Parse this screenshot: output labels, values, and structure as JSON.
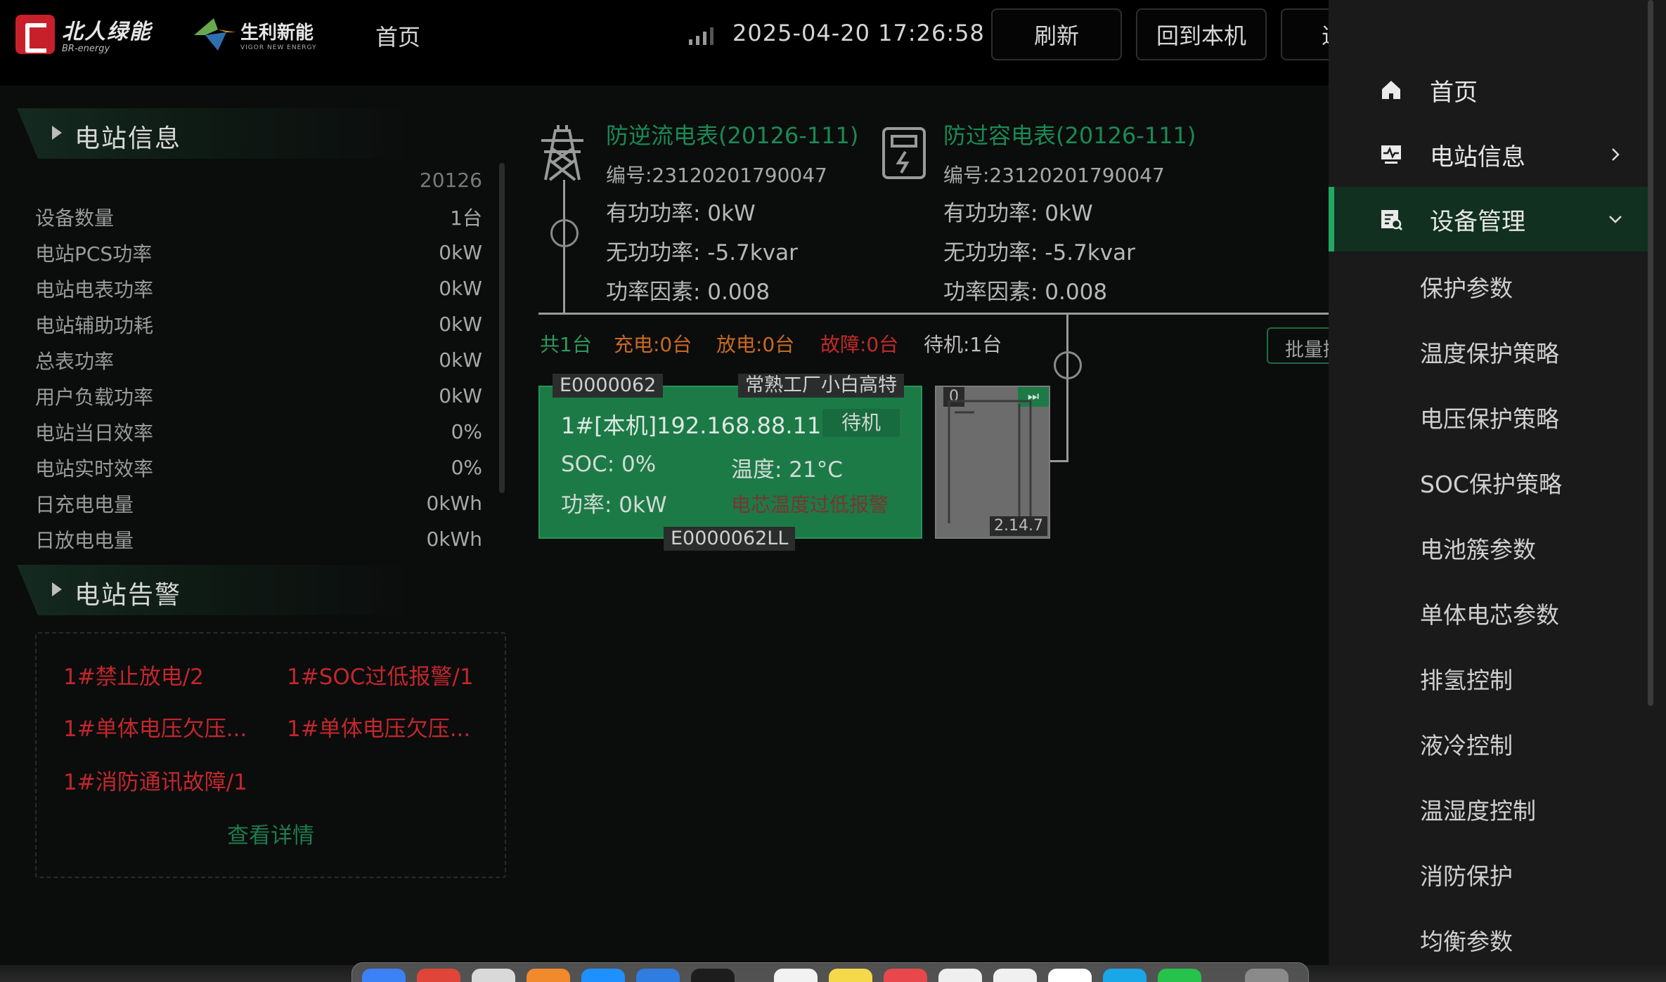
{
  "topbar": {
    "logo1_cn": "北人绿能",
    "logo1_en": "BR-energy",
    "logo2_cn": "生利新能",
    "logo2_en": "VIGOR NEW ENERGY",
    "nav_home": "首页",
    "datetime": "2025-04-20 17:26:58",
    "refresh_label": "刷新",
    "back_label": "回到本机",
    "third_label": "退"
  },
  "station_info": {
    "title": "电站信息",
    "station_id": "20126",
    "rows": [
      {
        "k": "设备数量",
        "v": "1台"
      },
      {
        "k": "电站PCS功率",
        "v": "0kW"
      },
      {
        "k": "电站电表功率",
        "v": "0kW"
      },
      {
        "k": "电站辅助功耗",
        "v": "0kW"
      },
      {
        "k": "总表功率",
        "v": "0kW"
      },
      {
        "k": "用户负载功率",
        "v": "0kW"
      },
      {
        "k": "电站当日效率",
        "v": "0%"
      },
      {
        "k": "电站实时效率",
        "v": "0%"
      },
      {
        "k": "日充电电量",
        "v": "0kWh"
      },
      {
        "k": "日放电电量",
        "v": "0kWh"
      }
    ]
  },
  "station_alarm": {
    "title": "电站告警",
    "items": [
      "1#禁止放电/2",
      "1#SOC过低报警/1",
      "1#单体电压欠压...",
      "1#单体电压欠压...",
      "1#消防通讯故障/1"
    ],
    "detail_label": "查看详情"
  },
  "meters": [
    {
      "name": "防逆流电表(20126-111)",
      "code": "编号:23120201790047",
      "active": "有功功率:  0kW",
      "reactive": "无功功率:  -5.7kvar",
      "pf": "功率因素:  0.008"
    },
    {
      "name": "防过容电表(20126-111)",
      "code": "编号:23120201790047",
      "active": "有功功率:  0kW",
      "reactive": "无功功率:  -5.7kvar",
      "pf": "功率因素:  0.008"
    }
  ],
  "status_bar": {
    "total": "共1台",
    "charging": "充电:0台",
    "discharging": "放电:0台",
    "fault": "故障:0台",
    "standby": "待机:1台",
    "batch_label": "批量操作",
    "colors": {
      "total": "#2a9a5e",
      "charging": "#c96a22",
      "discharging": "#c96a22",
      "fault": "#c22a2a",
      "standby": "#bdbdbd"
    }
  },
  "device": {
    "tag_left": "E0000062",
    "tag_right": "常熟工厂小白高特",
    "title": "1#[本机]192.168.88.111",
    "state": "待机",
    "soc": "SOC: 0%",
    "temp": "温度: 21°C",
    "power": "功率: 0kW",
    "alarm_text": "电芯温度过低报警",
    "tag_bottom": "E0000062LL"
  },
  "mini_unit": {
    "num": "0",
    "play_icon": "⏭",
    "version": "2.14.7"
  },
  "drawer": {
    "items": [
      {
        "label": "首页",
        "icon": "home-icon"
      },
      {
        "label": "电站信息",
        "icon": "monitor-icon"
      },
      {
        "label": "设备管理",
        "icon": "device-manage-icon"
      }
    ],
    "sub_items": [
      "保护参数",
      "温度保护策略",
      "电压保护策略",
      "SOC保护策略",
      "电池簇参数",
      "单体电芯参数",
      "排氢控制",
      "液冷控制",
      "温湿度控制",
      "消防保护",
      "均衡参数"
    ],
    "accent": "#22a862"
  }
}
